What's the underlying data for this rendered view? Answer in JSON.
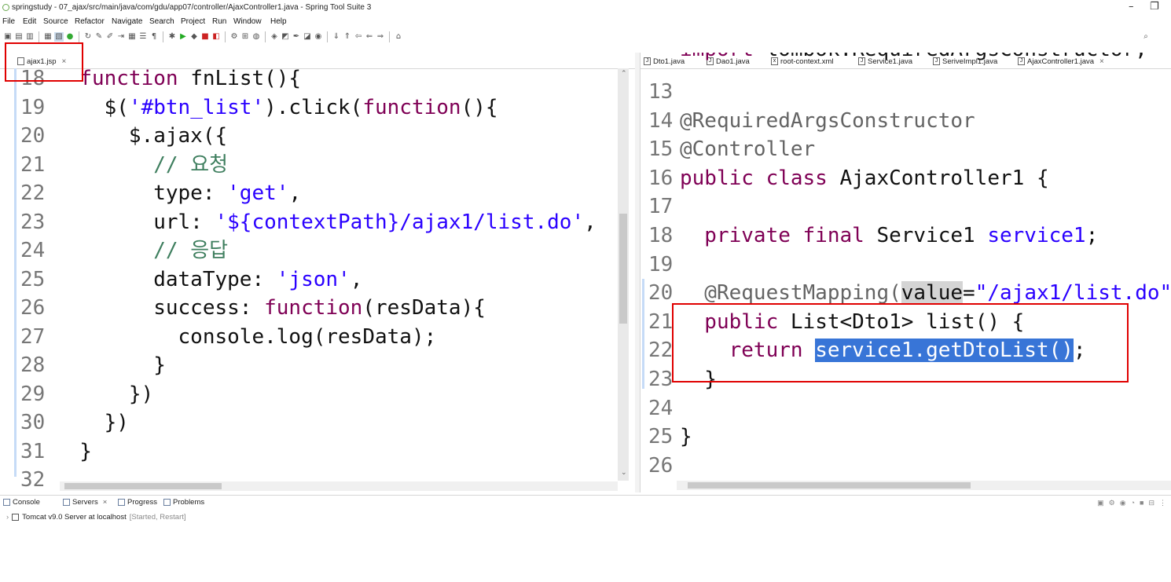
{
  "window": {
    "title": "springstudy - 07_ajax/src/main/java/com/gdu/app07/controller/AjaxController1.java - Spring Tool Suite 3",
    "minimize": "–",
    "restore": "❐"
  },
  "menu": [
    "File",
    "Edit",
    "Source",
    "Refactor",
    "Navigate",
    "Search",
    "Project",
    "Run",
    "Window",
    "Help"
  ],
  "left_editor": {
    "tab": "ajax1.jsp",
    "lines": [
      {
        "num": "18",
        "text": "  function fnList(){"
      },
      {
        "num": "19",
        "text": "    $('#btn_list').click(function(){"
      },
      {
        "num": "20",
        "text": "      $.ajax({"
      },
      {
        "num": "21",
        "text": "        // 요청"
      },
      {
        "num": "22",
        "text": "        type: 'get',"
      },
      {
        "num": "23",
        "text": "        url: '${contextPath}/ajax1/list.do',"
      },
      {
        "num": "24",
        "text": "        // 응답"
      },
      {
        "num": "25",
        "text": "        dataType: 'json',"
      },
      {
        "num": "26",
        "text": "        success: function(resData){"
      },
      {
        "num": "27",
        "text": "          console.log(resData);"
      },
      {
        "num": "28",
        "text": "        }"
      },
      {
        "num": "29",
        "text": "      })"
      },
      {
        "num": "30",
        "text": "    })"
      },
      {
        "num": "31",
        "text": "  }"
      },
      {
        "num": "32",
        "text": ""
      }
    ]
  },
  "right_editor": {
    "tabs": [
      "Dto1.java",
      "Dao1.java",
      "root-context.xml",
      "Service1.java",
      "SeriveImpl1.java",
      "AjaxController1.java"
    ],
    "active_tab": "AjaxController1.java",
    "line12_partial": "import lombok.RequiredArgsConstructor;",
    "lines": [
      {
        "num": "13",
        "parts": []
      },
      {
        "num": "14",
        "parts": [
          {
            "t": "@RequiredArgsConstructor",
            "c": "ann"
          }
        ]
      },
      {
        "num": "15",
        "parts": [
          {
            "t": "@Controller",
            "c": "ann"
          }
        ]
      },
      {
        "num": "16",
        "parts": [
          {
            "t": "public class ",
            "c": "kw"
          },
          {
            "t": "AjaxController1 {",
            "c": "plain"
          }
        ]
      },
      {
        "num": "17",
        "parts": []
      },
      {
        "num": "18",
        "parts": [
          {
            "t": "  private final ",
            "c": "kw"
          },
          {
            "t": "Service1 ",
            "c": "plain"
          },
          {
            "t": "service1",
            "c": "str"
          },
          {
            "t": ";",
            "c": "plain"
          }
        ]
      },
      {
        "num": "19",
        "parts": []
      },
      {
        "num": "20",
        "parts": [
          {
            "t": "  @RequestMapping(",
            "c": "ann"
          },
          {
            "t": "value",
            "c": "hv"
          },
          {
            "t": "=",
            "c": "plain"
          },
          {
            "t": "\"/ajax1/list.do\"",
            "c": "str"
          }
        ]
      },
      {
        "num": "21",
        "parts": [
          {
            "t": "  public ",
            "c": "kw"
          },
          {
            "t": "List<Dto1> list() {",
            "c": "plain"
          }
        ]
      },
      {
        "num": "22",
        "parts": [
          {
            "t": "    return ",
            "c": "kw"
          },
          {
            "t": "service1.getDtoList()",
            "c": "sel"
          },
          {
            "t": ";",
            "c": "plain"
          }
        ]
      },
      {
        "num": "23",
        "parts": [
          {
            "t": "  }",
            "c": "plain"
          }
        ]
      },
      {
        "num": "24",
        "parts": []
      },
      {
        "num": "25",
        "parts": [
          {
            "t": "}",
            "c": "plain"
          }
        ]
      },
      {
        "num": "26",
        "parts": []
      }
    ]
  },
  "bottom_panel": {
    "tabs": [
      "Console",
      "Servers",
      "Progress",
      "Problems"
    ],
    "server_name": "Tomcat v9.0 Server at localhost",
    "server_state": "[Started, Restart]"
  }
}
